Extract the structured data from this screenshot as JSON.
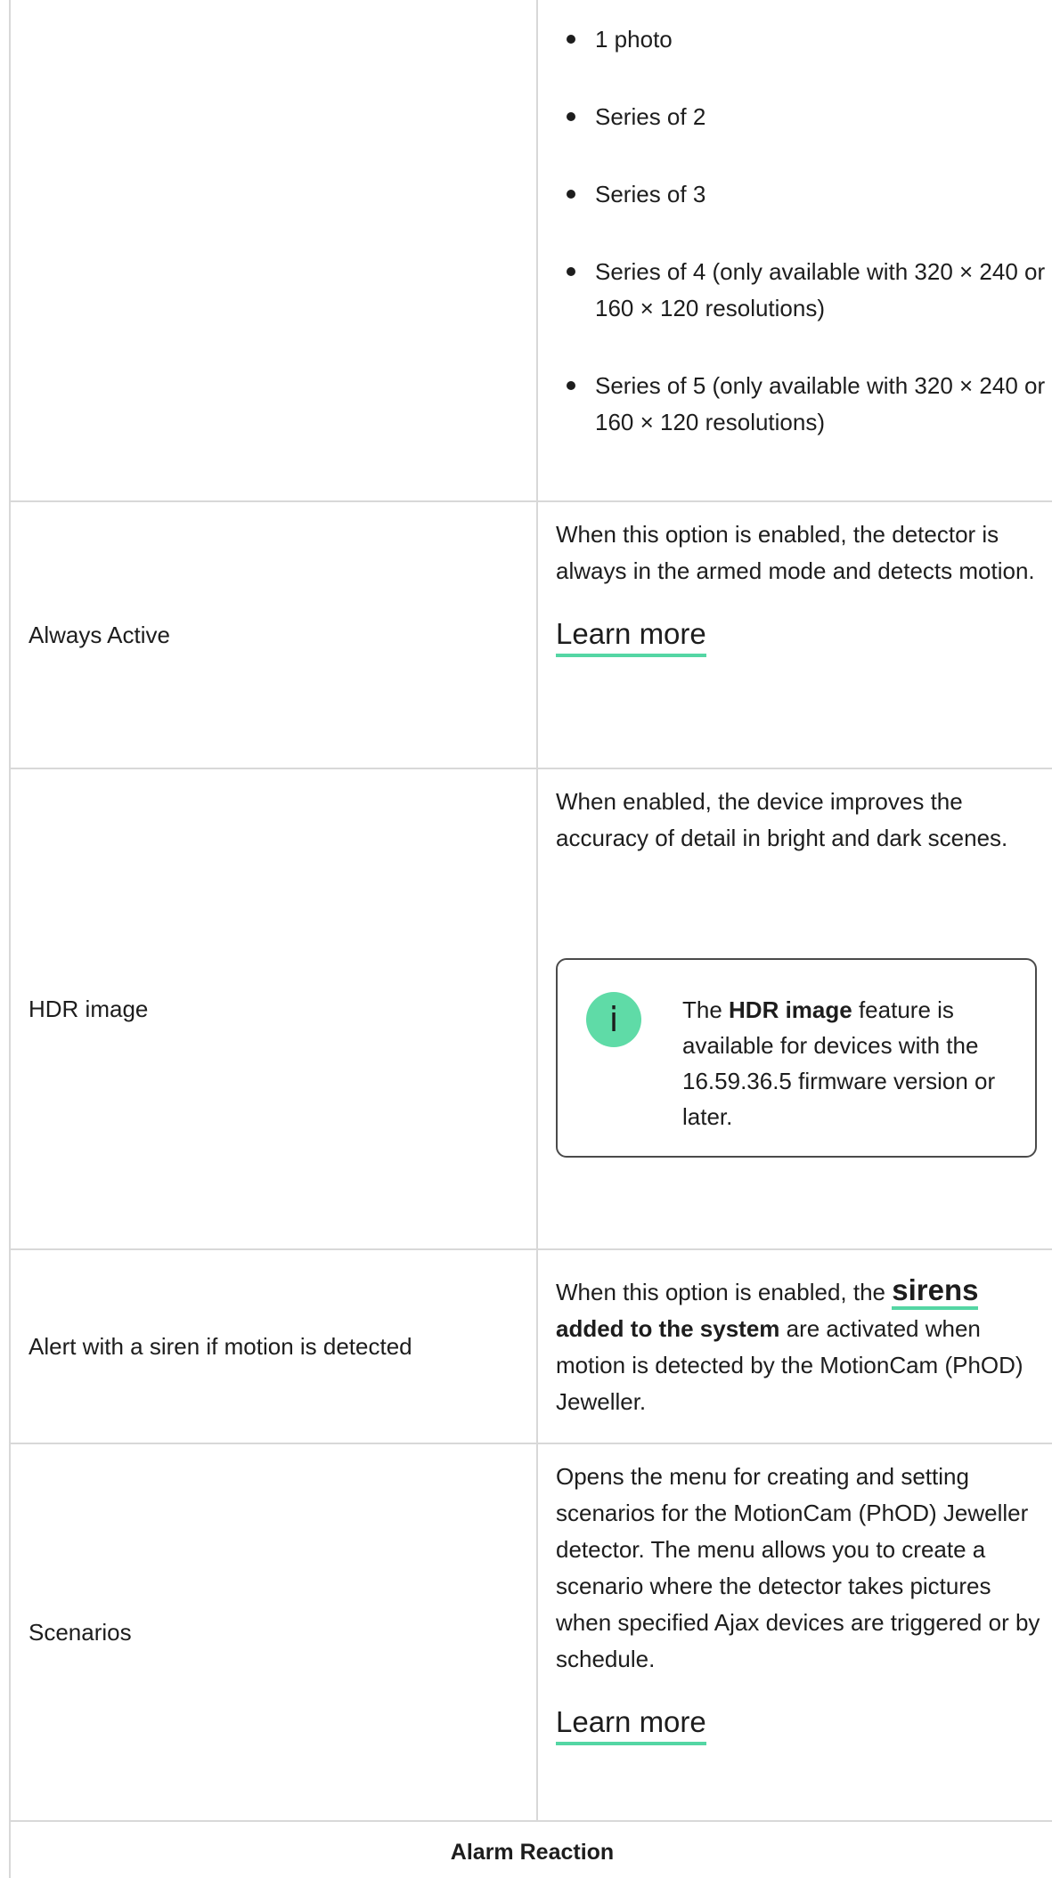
{
  "photo_series_options": [
    {
      "text": "1 photo"
    },
    {
      "text": "Series of 2"
    },
    {
      "text": "Series of 3"
    },
    {
      "text": "Series of 4 (only available with 320 × 240 or 160 × 120 resolutions)"
    },
    {
      "text": "Series of 5 (only available with 320 × 240 or 160 × 120 resolutions)"
    }
  ],
  "always_active": {
    "label": "Always Active",
    "description": "When this option is enabled, the detector is always in the armed mode and detects motion.",
    "link": "Learn more"
  },
  "hdr_image": {
    "label": "HDR image",
    "description": "When enabled, the device improves the accuracy of detail in bright and dark scenes.",
    "note_prefix": "The ",
    "note_bold": "HDR image",
    "note_suffix": " feature is available for devices with the 16.59.36.5 firmware version or later.",
    "icon": "info-icon"
  },
  "siren_alert": {
    "label": "Alert with a siren if motion is detected",
    "desc_prefix": "When this option is enabled, the ",
    "link": "sirens",
    "desc_bold": "added to the system",
    "desc_suffix": " are activated when motion is detected by the MotionCam (PhOD) Jeweller."
  },
  "scenarios": {
    "label": "Scenarios",
    "description": "Opens the menu for creating and setting scenarios for the MotionCam (PhOD) Jeweller detector. The menu allows you to create a scenario where the detector takes pictures when specified Ajax devices are triggered or by schedule.",
    "link": "Learn more"
  },
  "next_section": {
    "title": "Alarm Reaction"
  },
  "colors": {
    "accent": "#54d6a4",
    "border": "#d8d8d8",
    "text": "#1d1d1d"
  }
}
